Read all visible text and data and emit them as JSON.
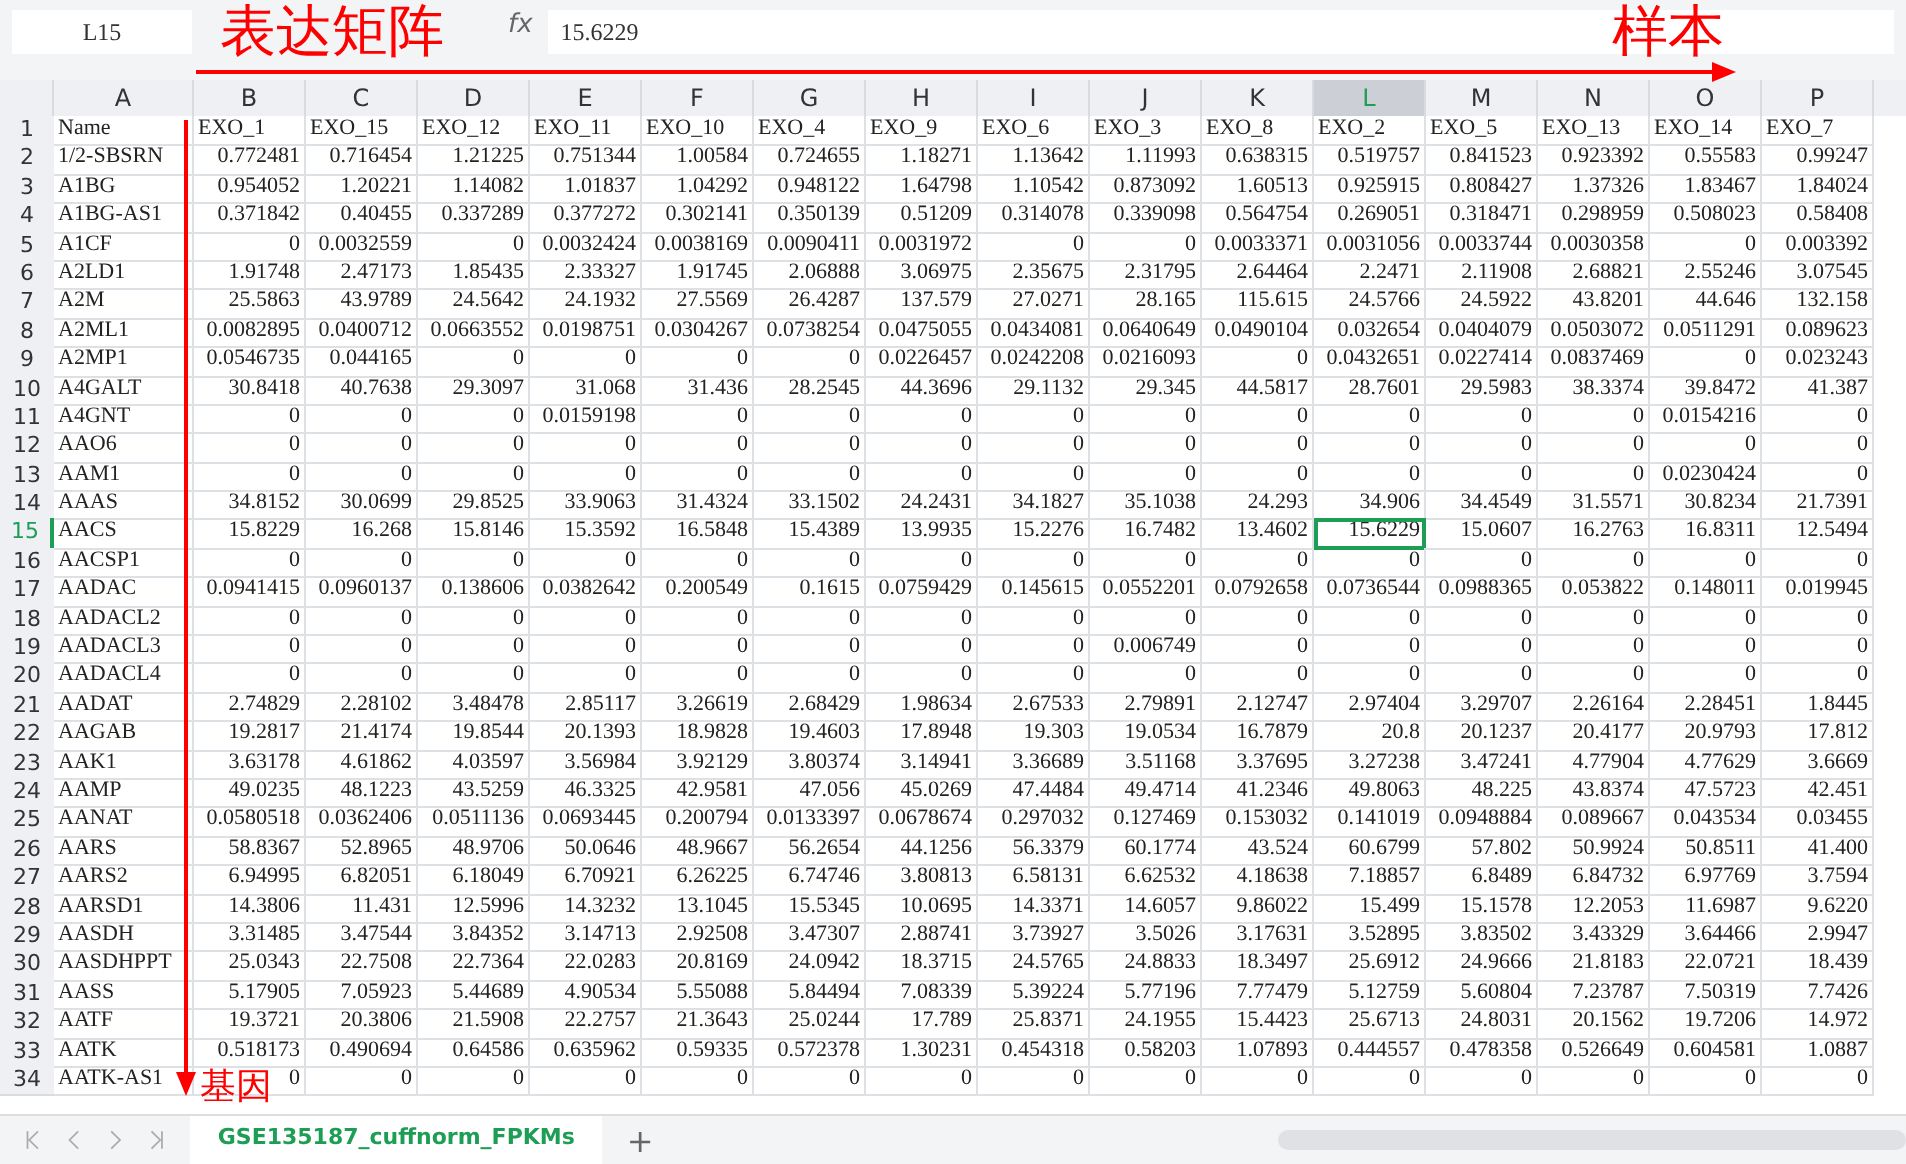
{
  "formula_bar": {
    "cell_ref": "L15",
    "fx": "fx",
    "value": "15.6229"
  },
  "columns": [
    {
      "letter": "A",
      "selected": false
    },
    {
      "letter": "B",
      "selected": false
    },
    {
      "letter": "C",
      "selected": false
    },
    {
      "letter": "D",
      "selected": false
    },
    {
      "letter": "E",
      "selected": false
    },
    {
      "letter": "F",
      "selected": false
    },
    {
      "letter": "G",
      "selected": false
    },
    {
      "letter": "H",
      "selected": false
    },
    {
      "letter": "I",
      "selected": false
    },
    {
      "letter": "J",
      "selected": false
    },
    {
      "letter": "K",
      "selected": false
    },
    {
      "letter": "L",
      "selected": true
    },
    {
      "letter": "M",
      "selected": false
    },
    {
      "letter": "N",
      "selected": false
    },
    {
      "letter": "O",
      "selected": false
    },
    {
      "letter": "P",
      "selected": false
    }
  ],
  "header_row": {
    "number": "1",
    "name": "Name",
    "samples": [
      "EXO_1",
      "EXO_15",
      "EXO_12",
      "EXO_11",
      "EXO_10",
      "EXO_4",
      "EXO_9",
      "EXO_6",
      "EXO_3",
      "EXO_8",
      "EXO_2",
      "EXO_5",
      "EXO_13",
      "EXO_14",
      "EXO_7"
    ]
  },
  "rows": [
    {
      "number": "2",
      "selected": false,
      "name": "1/2-SBSRN",
      "values": [
        "0.772481",
        "0.716454",
        "1.21225",
        "0.751344",
        "1.00584",
        "0.724655",
        "1.18271",
        "1.13642",
        "1.11993",
        "0.638315",
        "0.519757",
        "0.841523",
        "0.923392",
        "0.55583",
        "0.99247"
      ]
    },
    {
      "number": "3",
      "selected": false,
      "name": "A1BG",
      "values": [
        "0.954052",
        "1.20221",
        "1.14082",
        "1.01837",
        "1.04292",
        "0.948122",
        "1.64798",
        "1.10542",
        "0.873092",
        "1.60513",
        "0.925915",
        "0.808427",
        "1.37326",
        "1.83467",
        "1.84024"
      ]
    },
    {
      "number": "4",
      "selected": false,
      "name": "A1BG-AS1",
      "values": [
        "0.371842",
        "0.40455",
        "0.337289",
        "0.377272",
        "0.302141",
        "0.350139",
        "0.51209",
        "0.314078",
        "0.339098",
        "0.564754",
        "0.269051",
        "0.318471",
        "0.298959",
        "0.508023",
        "0.58408"
      ]
    },
    {
      "number": "5",
      "selected": false,
      "name": "A1CF",
      "values": [
        "0",
        "0.0032559",
        "0",
        "0.0032424",
        "0.0038169",
        "0.0090411",
        "0.0031972",
        "0",
        "0",
        "0.0033371",
        "0.0031056",
        "0.0033744",
        "0.0030358",
        "0",
        "0.003392"
      ]
    },
    {
      "number": "6",
      "selected": false,
      "name": "A2LD1",
      "values": [
        "1.91748",
        "2.47173",
        "1.85435",
        "2.33327",
        "1.91745",
        "2.06888",
        "3.06975",
        "2.35675",
        "2.31795",
        "2.64464",
        "2.2471",
        "2.11908",
        "2.68821",
        "2.55246",
        "3.07545"
      ]
    },
    {
      "number": "7",
      "selected": false,
      "name": "A2M",
      "values": [
        "25.5863",
        "43.9789",
        "24.5642",
        "24.1932",
        "27.5569",
        "26.4287",
        "137.579",
        "27.0271",
        "28.165",
        "115.615",
        "24.5766",
        "24.5922",
        "43.8201",
        "44.646",
        "132.158"
      ]
    },
    {
      "number": "8",
      "selected": false,
      "name": "A2ML1",
      "values": [
        "0.0082895",
        "0.0400712",
        "0.0663552",
        "0.0198751",
        "0.0304267",
        "0.0738254",
        "0.0475055",
        "0.0434081",
        "0.0640649",
        "0.0490104",
        "0.032654",
        "0.0404079",
        "0.0503072",
        "0.0511291",
        "0.089623"
      ]
    },
    {
      "number": "9",
      "selected": false,
      "name": "A2MP1",
      "values": [
        "0.0546735",
        "0.044165",
        "0",
        "0",
        "0",
        "0",
        "0.0226457",
        "0.0242208",
        "0.0216093",
        "0",
        "0.0432651",
        "0.0227414",
        "0.0837469",
        "0",
        "0.023243"
      ]
    },
    {
      "number": "10",
      "selected": false,
      "name": "A4GALT",
      "values": [
        "30.8418",
        "40.7638",
        "29.3097",
        "31.068",
        "31.436",
        "28.2545",
        "44.3696",
        "29.1132",
        "29.345",
        "44.5817",
        "28.7601",
        "29.5983",
        "38.3374",
        "39.8472",
        "41.387"
      ]
    },
    {
      "number": "11",
      "selected": false,
      "name": "A4GNT",
      "values": [
        "0",
        "0",
        "0",
        "0.0159198",
        "0",
        "0",
        "0",
        "0",
        "0",
        "0",
        "0",
        "0",
        "0",
        "0.0154216",
        "0"
      ]
    },
    {
      "number": "12",
      "selected": false,
      "name": "AAO6",
      "values": [
        "0",
        "0",
        "0",
        "0",
        "0",
        "0",
        "0",
        "0",
        "0",
        "0",
        "0",
        "0",
        "0",
        "0",
        "0"
      ]
    },
    {
      "number": "13",
      "selected": false,
      "name": "AAM1",
      "values": [
        "0",
        "0",
        "0",
        "0",
        "0",
        "0",
        "0",
        "0",
        "0",
        "0",
        "0",
        "0",
        "0",
        "0.0230424",
        "0"
      ]
    },
    {
      "number": "14",
      "selected": false,
      "name": "AAAS",
      "values": [
        "34.8152",
        "30.0699",
        "29.8525",
        "33.9063",
        "31.4324",
        "33.1502",
        "24.2431",
        "34.1827",
        "35.1038",
        "24.293",
        "34.906",
        "34.4549",
        "31.5571",
        "30.8234",
        "21.7391"
      ]
    },
    {
      "number": "15",
      "selected": true,
      "name": "AACS",
      "values": [
        "15.8229",
        "16.268",
        "15.8146",
        "15.3592",
        "16.5848",
        "15.4389",
        "13.9935",
        "15.2276",
        "16.7482",
        "13.4602",
        "15.6229",
        "15.0607",
        "16.2763",
        "16.8311",
        "12.5494"
      ]
    },
    {
      "number": "16",
      "selected": false,
      "name": "AACSP1",
      "values": [
        "0",
        "0",
        "0",
        "0",
        "0",
        "0",
        "0",
        "0",
        "0",
        "0",
        "0",
        "0",
        "0",
        "0",
        "0"
      ]
    },
    {
      "number": "17",
      "selected": false,
      "name": "AADAC",
      "values": [
        "0.0941415",
        "0.0960137",
        "0.138606",
        "0.0382642",
        "0.200549",
        "0.1615",
        "0.0759429",
        "0.145615",
        "0.0552201",
        "0.0792658",
        "0.0736544",
        "0.0988365",
        "0.053822",
        "0.148011",
        "0.019945"
      ]
    },
    {
      "number": "18",
      "selected": false,
      "name": "AADACL2",
      "values": [
        "0",
        "0",
        "0",
        "0",
        "0",
        "0",
        "0",
        "0",
        "0",
        "0",
        "0",
        "0",
        "0",
        "0",
        "0"
      ]
    },
    {
      "number": "19",
      "selected": false,
      "name": "AADACL3",
      "values": [
        "0",
        "0",
        "0",
        "0",
        "0",
        "0",
        "0",
        "0",
        "0.006749",
        "0",
        "0",
        "0",
        "0",
        "0",
        "0"
      ]
    },
    {
      "number": "20",
      "selected": false,
      "name": "AADACL4",
      "values": [
        "0",
        "0",
        "0",
        "0",
        "0",
        "0",
        "0",
        "0",
        "0",
        "0",
        "0",
        "0",
        "0",
        "0",
        "0"
      ]
    },
    {
      "number": "21",
      "selected": false,
      "name": "AADAT",
      "values": [
        "2.74829",
        "2.28102",
        "3.48478",
        "2.85117",
        "3.26619",
        "2.68429",
        "1.98634",
        "2.67533",
        "2.79891",
        "2.12747",
        "2.97404",
        "3.29707",
        "2.26164",
        "2.28451",
        "1.8445"
      ]
    },
    {
      "number": "22",
      "selected": false,
      "name": "AAGAB",
      "values": [
        "19.2817",
        "21.4174",
        "19.8544",
        "20.1393",
        "18.9828",
        "19.4603",
        "17.8948",
        "19.303",
        "19.0534",
        "16.7879",
        "20.8",
        "20.1237",
        "20.4177",
        "20.9793",
        "17.812"
      ]
    },
    {
      "number": "23",
      "selected": false,
      "name": "AAK1",
      "values": [
        "3.63178",
        "4.61862",
        "4.03597",
        "3.56984",
        "3.92129",
        "3.80374",
        "3.14941",
        "3.36689",
        "3.51168",
        "3.37695",
        "3.27238",
        "3.47241",
        "4.77904",
        "4.77629",
        "3.6669"
      ]
    },
    {
      "number": "24",
      "selected": false,
      "name": "AAMP",
      "values": [
        "49.0235",
        "48.1223",
        "43.5259",
        "46.3325",
        "42.9581",
        "47.056",
        "45.0269",
        "47.4484",
        "49.4714",
        "41.2346",
        "49.8063",
        "48.225",
        "43.8374",
        "47.5723",
        "42.451"
      ]
    },
    {
      "number": "25",
      "selected": false,
      "name": "AANAT",
      "values": [
        "0.0580518",
        "0.0362406",
        "0.0511136",
        "0.0693445",
        "0.200794",
        "0.0133397",
        "0.0678674",
        "0.297032",
        "0.127469",
        "0.153032",
        "0.141019",
        "0.0948884",
        "0.089667",
        "0.043534",
        "0.03455"
      ]
    },
    {
      "number": "26",
      "selected": false,
      "name": "AARS",
      "values": [
        "58.8367",
        "52.8965",
        "48.9706",
        "50.0646",
        "48.9667",
        "56.2654",
        "44.1256",
        "56.3379",
        "60.1774",
        "43.524",
        "60.6799",
        "57.802",
        "50.9924",
        "50.8511",
        "41.400"
      ]
    },
    {
      "number": "27",
      "selected": false,
      "name": "AARS2",
      "values": [
        "6.94995",
        "6.82051",
        "6.18049",
        "6.70921",
        "6.26225",
        "6.74746",
        "3.80813",
        "6.58131",
        "6.62532",
        "4.18638",
        "7.18857",
        "6.8489",
        "6.84732",
        "6.97769",
        "3.7594"
      ]
    },
    {
      "number": "28",
      "selected": false,
      "name": "AARSD1",
      "values": [
        "14.3806",
        "11.431",
        "12.5996",
        "14.3232",
        "13.1045",
        "15.5345",
        "10.0695",
        "14.3371",
        "14.6057",
        "9.86022",
        "15.499",
        "15.1578",
        "12.2053",
        "11.6987",
        "9.6220"
      ]
    },
    {
      "number": "29",
      "selected": false,
      "name": "AASDH",
      "values": [
        "3.31485",
        "3.47544",
        "3.84352",
        "3.14713",
        "2.92508",
        "3.47307",
        "2.88741",
        "3.73927",
        "3.5026",
        "3.17631",
        "3.52895",
        "3.83502",
        "3.43329",
        "3.64466",
        "2.9947"
      ]
    },
    {
      "number": "30",
      "selected": false,
      "name": "AASDHPPT",
      "values": [
        "25.0343",
        "22.7508",
        "22.7364",
        "22.0283",
        "20.8169",
        "24.0942",
        "18.3715",
        "24.5765",
        "24.8833",
        "18.3497",
        "25.6912",
        "24.9666",
        "21.8183",
        "22.0721",
        "18.439"
      ]
    },
    {
      "number": "31",
      "selected": false,
      "name": "AASS",
      "values": [
        "5.17905",
        "7.05923",
        "5.44689",
        "4.90534",
        "5.55088",
        "5.84494",
        "7.08339",
        "5.39224",
        "5.77196",
        "7.77479",
        "5.12759",
        "5.60804",
        "7.23787",
        "7.50319",
        "7.7426"
      ]
    },
    {
      "number": "32",
      "selected": false,
      "name": "AATF",
      "values": [
        "19.3721",
        "20.3806",
        "21.5908",
        "22.2757",
        "21.3643",
        "25.0244",
        "17.789",
        "25.8371",
        "24.1955",
        "15.4423",
        "25.6713",
        "24.8031",
        "20.1562",
        "19.7206",
        "14.972"
      ]
    },
    {
      "number": "33",
      "selected": false,
      "name": "AATK",
      "values": [
        "0.518173",
        "0.490694",
        "0.64586",
        "0.635962",
        "0.59335",
        "0.572378",
        "1.30231",
        "0.454318",
        "0.58203",
        "1.07893",
        "0.444557",
        "0.478358",
        "0.526649",
        "0.604581",
        "1.0887"
      ]
    },
    {
      "number": "34",
      "selected": false,
      "name": "AATK-AS1",
      "values": [
        "0",
        "0",
        "0",
        "0",
        "0",
        "0",
        "0",
        "0",
        "0",
        "0",
        "0",
        "0",
        "0",
        "0",
        "0"
      ]
    }
  ],
  "sheet_tabs": [
    {
      "label": "GSE135187_cuffnorm_FPKMs",
      "selected": true
    }
  ],
  "add_sheet": "+",
  "annotations": [
    {
      "kind": "horizontal",
      "label": "表达矩阵"
    },
    {
      "kind": "horizontal-end",
      "label": "样本"
    },
    {
      "kind": "vertical",
      "label": "基因"
    }
  ]
}
